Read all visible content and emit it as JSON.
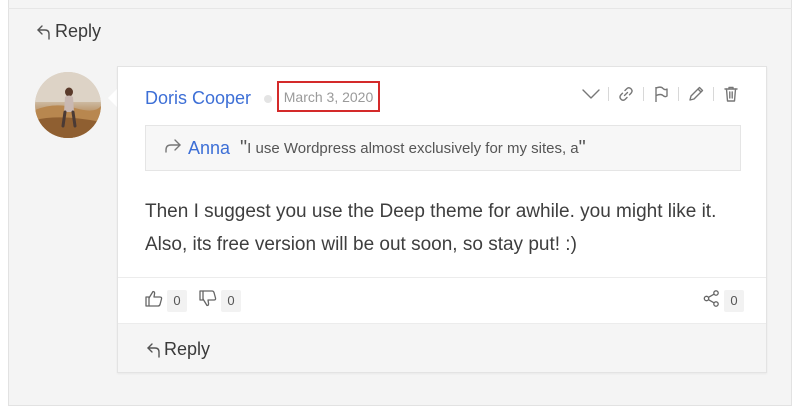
{
  "reply_top": {
    "label": "Reply",
    "icon": "reply-icon"
  },
  "comment": {
    "author": "Doris Cooper",
    "date": "March 3, 2020",
    "actions": [
      "collapse-icon",
      "link-icon",
      "flag-icon",
      "edit-icon",
      "delete-icon"
    ],
    "quote": {
      "name": "Anna",
      "open_mark": "\"",
      "text": "I use Wordpress almost exclusively for my sites, a",
      "close_mark": "\""
    },
    "body_line1": "Then I suggest you use the Deep theme for awhile. you might like it.",
    "body_line2": "Also, its free version will be out soon, so stay put! :)",
    "likes": "0",
    "dislikes": "0",
    "shares": "0",
    "reply_label": "Reply"
  },
  "colors": {
    "link": "#3d6fd6",
    "highlight_border": "#d42a2a"
  }
}
